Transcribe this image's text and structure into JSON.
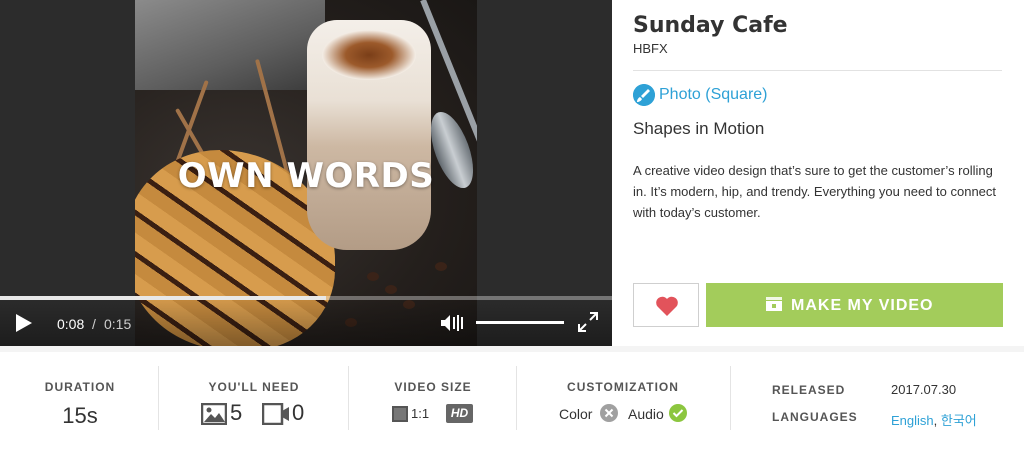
{
  "player": {
    "overlay_title": "OWN WORDS",
    "current_time": "0:08",
    "time_separator": "/",
    "duration": "0:15",
    "progress_fraction": 0.533,
    "volume_fraction": 1.0
  },
  "info": {
    "title": "Sunday Cafe",
    "author": "HBFX",
    "category_link": "Photo (Square)",
    "style_name": "Shapes in Motion",
    "description": "A creative video design that’s sure to get the customer’s rolling in. It’s modern, hip, and trendy. Everything you need to connect with today’s customer.",
    "make_button_label": "MAKE MY VIDEO"
  },
  "details": {
    "duration_label": "DURATION",
    "duration_value": "15s",
    "need_label": "YOU'LL NEED",
    "need_images": "5",
    "need_videos": "0",
    "size_label": "VIDEO SIZE",
    "size_ratio": "1:1",
    "size_hd": "HD",
    "custom_label": "CUSTOMIZATION",
    "custom_color": "Color",
    "custom_audio": "Audio",
    "released_label": "RELEASED",
    "released_value": "2017.07.30",
    "languages_label": "LANGUAGES",
    "lang_en": "English",
    "lang_sep": ",",
    "lang_ko": "한국어"
  },
  "colors": {
    "accent_blue": "#2ea1d6",
    "make_green": "#a3cc5b",
    "heart_red": "#e2535b",
    "check_green": "#8cc63f",
    "cross_gray": "#a0a0a0"
  }
}
